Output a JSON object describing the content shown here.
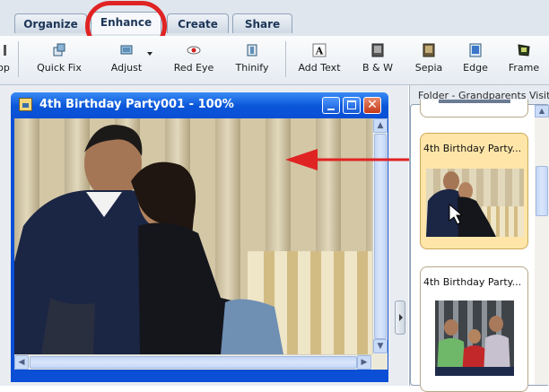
{
  "tabs": [
    {
      "label": "Organize"
    },
    {
      "label": "Enhance",
      "active": true
    },
    {
      "label": "Create"
    },
    {
      "label": "Share"
    }
  ],
  "toolbar": {
    "items": [
      {
        "label": "op",
        "icon": "crop-icon"
      },
      {
        "label": "Quick Fix",
        "icon": "quick-fix-icon"
      },
      {
        "label": "Adjust",
        "icon": "adjust-icon"
      },
      {
        "label": "Red Eye",
        "icon": "red-eye-icon"
      },
      {
        "label": "Thinify",
        "icon": "thinify-icon"
      },
      {
        "label": "Add Text",
        "icon": "add-text-icon"
      },
      {
        "label": "B & W",
        "icon": "black-white-icon"
      },
      {
        "label": "Sepia",
        "icon": "sepia-icon"
      },
      {
        "label": "Edge",
        "icon": "edge-icon"
      },
      {
        "label": "Frame",
        "icon": "frame-icon"
      }
    ]
  },
  "image_window": {
    "title": "4th Birthday Party001 - 100%"
  },
  "photo_bin": {
    "header": "Folder - Grandparents Visit",
    "items": [
      {
        "label": "4th Birthday Party...",
        "selected": true
      },
      {
        "label": "4th Birthday Party...",
        "selected": false
      }
    ]
  },
  "colors": {
    "highlight_ring": "#e02323",
    "arrow": "#e02323",
    "title_bar": "#0a56d8",
    "selected_card": "#ffe6a8"
  }
}
